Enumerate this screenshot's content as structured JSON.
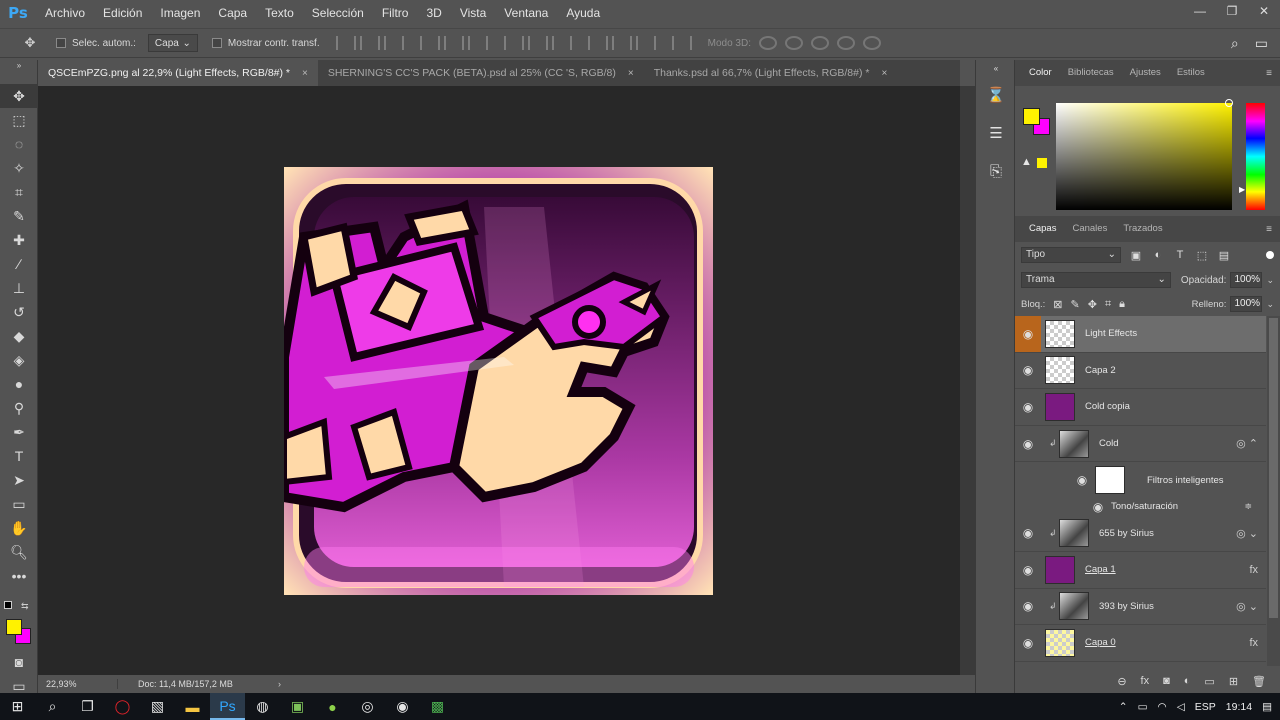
{
  "app": {
    "logo": "Ps"
  },
  "menu": [
    "Archivo",
    "Edición",
    "Imagen",
    "Capa",
    "Texto",
    "Selección",
    "Filtro",
    "3D",
    "Vista",
    "Ventana",
    "Ayuda"
  ],
  "window_controls": {
    "minimize": "—",
    "restore": "❐",
    "close": "✕"
  },
  "options": {
    "auto_select_label": "Selec. autom.:",
    "auto_select_target": "Capa",
    "show_transform_label": "Mostrar contr. transf.",
    "mode_3d_label": "Modo 3D:"
  },
  "tabs": [
    {
      "title": "QSCEmPZG.png al 22,9% (Light Effects, RGB/8#) *",
      "close": "×"
    },
    {
      "title": "SHERNING'S CC'S PACK (BETA).psd al 25% (CC 'S, RGB/8)",
      "close": "×"
    },
    {
      "title": "Thanks.psd al 66,7% (Light Effects, RGB/8#) *",
      "close": "×"
    }
  ],
  "status": {
    "zoom": "22,93%",
    "doc": "Doc: 11,4 MB/157,2 MB",
    "arrow": "›"
  },
  "color_panel": {
    "tabs": [
      "Color",
      "Bibliotecas",
      "Ajustes",
      "Estilos"
    ],
    "foreground": "#fff200",
    "background": "#ff00ff",
    "gamut_warning": "▲"
  },
  "layers_panel": {
    "tabs": [
      "Capas",
      "Canales",
      "Trazados"
    ],
    "kind": "Tipo",
    "blend_mode": "Trama",
    "opacity_label": "Opacidad:",
    "opacity": "100%",
    "lock_label": "Bloq.:",
    "fill_label": "Relleno:",
    "fill": "100%",
    "layers": [
      {
        "name": "Light Effects",
        "selected": true
      },
      {
        "name": "Capa 2"
      },
      {
        "name": "Cold copia"
      },
      {
        "name": "Cold"
      },
      {
        "name": "Filtros inteligentes"
      },
      {
        "name": "Tono/saturación"
      },
      {
        "name": "655 by Sirius"
      },
      {
        "name": "Capa 1"
      },
      {
        "name": "393 by Sirius"
      },
      {
        "name": "Capa 0"
      }
    ],
    "fx_label": "fx"
  },
  "taskbar": {
    "language": "ESP",
    "time": "19:14"
  },
  "colors": {
    "accent_selected_eye": "#b8651c",
    "artwork_magenta": "#d21ed2",
    "artwork_peach": "#ffd9a8"
  }
}
